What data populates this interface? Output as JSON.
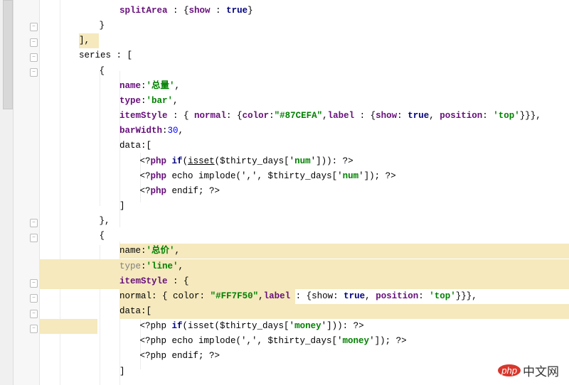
{
  "editor": {
    "lines": [
      {
        "indent": 4,
        "tokens": [
          [
            "splitArea",
            "k"
          ],
          [
            " : {",
            "p"
          ],
          [
            "show",
            "k"
          ],
          [
            " : ",
            "p"
          ],
          [
            "true",
            "b"
          ],
          [
            "}",
            "p"
          ]
        ]
      },
      {
        "indent": 3,
        "tokens": [
          [
            "}",
            "p"
          ]
        ]
      },
      {
        "indent": 2,
        "tokens": [
          [
            "]",
            "p"
          ],
          [
            ",",
            "p"
          ]
        ],
        "hl": [
          [
            56,
            84
          ]
        ]
      },
      {
        "indent": 2,
        "tokens": [
          [
            "series : [",
            "p"
          ]
        ]
      },
      {
        "indent": 3,
        "tokens": [
          [
            "{",
            "p"
          ]
        ]
      },
      {
        "indent": 4,
        "tokens": [
          [
            "name",
            "k"
          ],
          [
            ":",
            "p"
          ],
          [
            "'总量'",
            "s"
          ],
          [
            ",",
            "p"
          ]
        ]
      },
      {
        "indent": 4,
        "tokens": [
          [
            "type",
            "k"
          ],
          [
            ":",
            "p"
          ],
          [
            "'bar'",
            "s"
          ],
          [
            ",",
            "p"
          ]
        ]
      },
      {
        "indent": 4,
        "tokens": [
          [
            "itemStyle",
            "k"
          ],
          [
            " : { ",
            "p"
          ],
          [
            "normal",
            "k"
          ],
          [
            ": {",
            "p"
          ],
          [
            "color",
            "k"
          ],
          [
            ":",
            "p"
          ],
          [
            "\"#87CEFA\"",
            "s"
          ],
          [
            ",",
            "p"
          ],
          [
            "label",
            "k"
          ],
          [
            " : {",
            "p"
          ],
          [
            "show",
            "k"
          ],
          [
            ": ",
            "p"
          ],
          [
            "true",
            "b"
          ],
          [
            ", ",
            "p"
          ],
          [
            "position",
            "k"
          ],
          [
            ": ",
            "p"
          ],
          [
            "'top'",
            "s"
          ],
          [
            "}}},",
            "p"
          ]
        ]
      },
      {
        "indent": 4,
        "tokens": [
          [
            "barWidth",
            "k"
          ],
          [
            ":",
            "p"
          ],
          [
            "30",
            "n"
          ],
          [
            ",",
            "p"
          ]
        ]
      },
      {
        "indent": 4,
        "tokens": [
          [
            "data:[",
            "p"
          ]
        ]
      },
      {
        "indent": 5,
        "tokens": [
          [
            "<?",
            "tag"
          ],
          [
            "php",
            "k"
          ],
          [
            " ",
            "p"
          ],
          [
            "if",
            "b"
          ],
          [
            "(",
            "p"
          ],
          [
            "isset",
            "u"
          ],
          [
            "($thirty_days['",
            "p"
          ],
          [
            "num",
            "s"
          ],
          [
            "'])): ?>",
            "p"
          ]
        ]
      },
      {
        "indent": 5,
        "tokens": [
          [
            "<?",
            "tag"
          ],
          [
            "php",
            "k"
          ],
          [
            " echo implode(',', $thirty_days['",
            "p"
          ],
          [
            "num",
            "s"
          ],
          [
            "']); ?>",
            "p"
          ]
        ]
      },
      {
        "indent": 5,
        "tokens": [
          [
            "<?",
            "tag"
          ],
          [
            "php",
            "k"
          ],
          [
            " endif; ?>",
            "p"
          ]
        ]
      },
      {
        "indent": 4,
        "tokens": [
          [
            "]",
            "p"
          ]
        ]
      },
      {
        "indent": 3,
        "tokens": [
          [
            "},",
            "p"
          ]
        ]
      },
      {
        "indent": 3,
        "tokens": [
          [
            "{",
            "p"
          ]
        ]
      },
      {
        "indent": 4,
        "tokens": [
          [
            "name",
            "p"
          ],
          [
            ":",
            "p"
          ],
          [
            "'总价'",
            "s"
          ],
          [
            ",",
            "p"
          ]
        ],
        "hl": [
          [
            113,
            745
          ]
        ]
      },
      {
        "indent": 4,
        "tokens": [
          [
            "type",
            "g"
          ],
          [
            ":",
            "p"
          ],
          [
            "'line'",
            "s"
          ],
          [
            ",",
            "p"
          ]
        ],
        "hl": [
          [
            0,
            745
          ]
        ]
      },
      {
        "indent": 4,
        "tokens": [
          [
            "itemStyle",
            "k"
          ],
          [
            " : {",
            "p"
          ]
        ],
        "hl": [
          [
            0,
            745
          ]
        ]
      },
      {
        "indent": 4,
        "tokens": [
          [
            "normal",
            "p"
          ],
          [
            ": { ",
            "p"
          ],
          [
            "color",
            "p"
          ],
          [
            ": ",
            "p"
          ],
          [
            "\"#FF7F50\"",
            "s"
          ],
          [
            ",",
            "p"
          ],
          [
            "label",
            "k"
          ],
          [
            " : {",
            "p"
          ],
          [
            "show",
            "p"
          ],
          [
            ": ",
            "p"
          ],
          [
            "true",
            "b"
          ],
          [
            ", ",
            "p"
          ],
          [
            "position",
            "k"
          ],
          [
            ": ",
            "p"
          ],
          [
            "'top'",
            "s"
          ],
          [
            "}}},",
            "p"
          ]
        ],
        "hl": [
          [
            113,
            360
          ]
        ]
      },
      {
        "indent": 4,
        "tokens": [
          [
            "data",
            "p"
          ],
          [
            ":[",
            "p"
          ]
        ],
        "hl": [
          [
            113,
            745
          ]
        ]
      },
      {
        "indent": 5,
        "tokens": [
          [
            "<?php ",
            "p"
          ],
          [
            "if",
            "b"
          ],
          [
            "(isset($thirty_days['",
            "p"
          ],
          [
            "money",
            "s"
          ],
          [
            "'])): ?>",
            "p"
          ]
        ],
        "hl": [
          [
            0,
            82
          ]
        ]
      },
      {
        "indent": 5,
        "tokens": [
          [
            "<?php echo implode(',', $thirty_days['",
            "p"
          ],
          [
            "money",
            "s"
          ],
          [
            "']); ?>",
            "p"
          ]
        ]
      },
      {
        "indent": 5,
        "tokens": [
          [
            "<?php endif; ?>",
            "p"
          ]
        ]
      },
      {
        "indent": 4,
        "tokens": [
          [
            "]",
            "p"
          ]
        ]
      }
    ]
  },
  "watermark": {
    "brand": "php",
    "text": "中文网"
  }
}
